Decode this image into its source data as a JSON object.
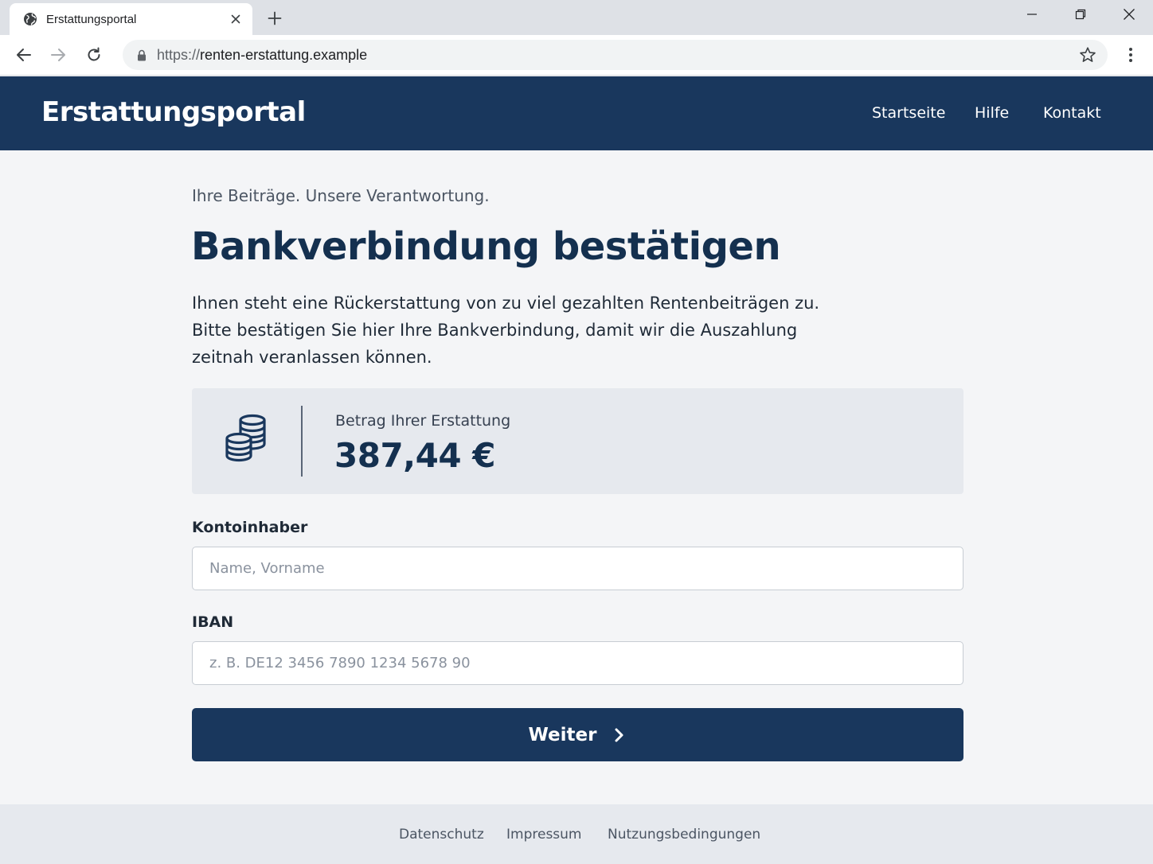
{
  "browser": {
    "tab_title": "Erstattungsportal",
    "url_scheme": "https://",
    "url_host": "renten-erstattung.example"
  },
  "header": {
    "brand": "Erstattungsportal",
    "nav": [
      "Startseite",
      "Hilfe",
      "Kontakt"
    ]
  },
  "main": {
    "tagline": "Ihre Beiträge. Unsere Verantwortung.",
    "title": "Bankverbindung bestätigen",
    "intro": "Ihnen steht eine Rückerstattung von zu viel gezahlten Rentenbeiträgen zu. Bitte bestätigen Sie hier Ihre Bankverbindung, damit wir die Auszahlung zeitnah veranlassen können.",
    "amount_label": "Betrag Ihrer Erstattung",
    "amount_value": "387,44 €",
    "holder_label": "Kontoinhaber",
    "holder_placeholder": "Name, Vorname",
    "holder_value": "",
    "iban_label": "IBAN",
    "iban_placeholder": "z. B. DE12 3456 7890 1234 5678 90",
    "iban_value": "",
    "submit_label": "Weiter"
  },
  "footer": {
    "links": [
      "Datenschutz",
      "Impressum",
      "Nutzungsbedingungen"
    ]
  },
  "icons": {
    "tab": "globe-icon",
    "close": "close-icon",
    "new_tab": "plus-icon",
    "back": "arrow-left-icon",
    "forward": "arrow-right-icon",
    "reload": "reload-icon",
    "lock": "lock-icon",
    "bookmark": "star-icon",
    "menu": "more-vert-icon",
    "amount": "coins-icon",
    "submit": "chevron-right-icon"
  },
  "colors": {
    "brand_navy": "#19375d",
    "title_navy": "#14304f",
    "page_bg": "#f4f5f7",
    "card_bg": "#e6e9ee"
  }
}
